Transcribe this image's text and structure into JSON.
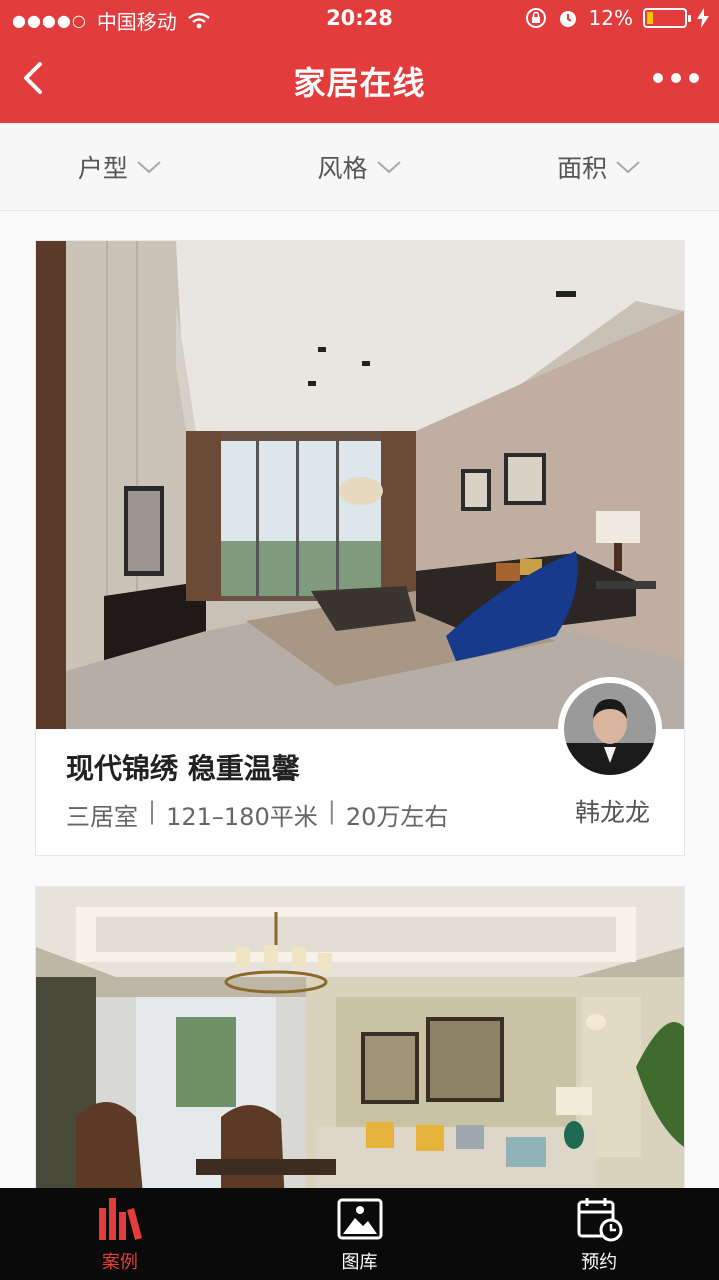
{
  "status": {
    "carrier": "中国移动",
    "time": "20:28",
    "battery": "12%"
  },
  "header": {
    "title": "家居在线"
  },
  "filters": [
    {
      "label": "户型"
    },
    {
      "label": "风格"
    },
    {
      "label": "面积"
    }
  ],
  "cards": [
    {
      "title": "现代锦绣 稳重温馨",
      "rooms": "三居室",
      "area": "121–180平米",
      "budget": "20万左右",
      "designer": "韩龙龙"
    }
  ],
  "tabs": [
    {
      "label": "案例",
      "icon": "books-icon",
      "active": true
    },
    {
      "label": "图库",
      "icon": "picture-icon",
      "active": false
    },
    {
      "label": "预约",
      "icon": "calendar-clock-icon",
      "active": false
    }
  ],
  "colors": {
    "accent": "#e23c3c",
    "tabbar": "#0a0a0a"
  }
}
